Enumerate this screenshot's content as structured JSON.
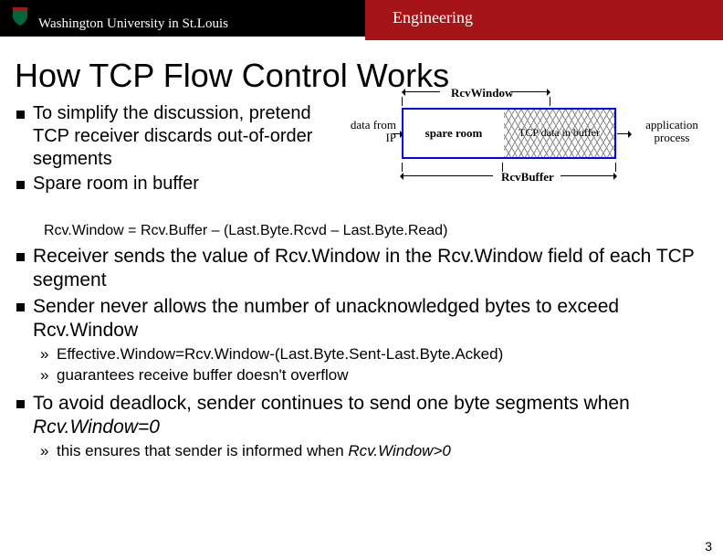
{
  "header": {
    "university": "Washington University in St.Louis",
    "dept": "Engineering"
  },
  "title": "How TCP Flow Control Works",
  "bullets_top": [
    "To simplify the discussion, pretend TCP receiver discards out-of-order segments",
    "Spare room in buffer"
  ],
  "diagram": {
    "rcvwindow": "RcvWindow",
    "data_from": "data from IP",
    "spare": "spare room",
    "tcp_data": "TCP data in buffer",
    "app_proc": "application process",
    "rcvbuffer": "RcvBuffer"
  },
  "formula": "Rcv.Window = Rcv.Buffer – (Last.Byte.Rcvd – Last.Byte.Read)",
  "bullets_main": [
    "Receiver sends the value of Rcv.Window in the Rcv.Window field of each TCP segment",
    "Sender never allows the number of unacknowledged bytes to exceed Rcv.Window"
  ],
  "sub1": [
    "Effective.Window=Rcv.Window-(Last.Byte.Sent-Last.Byte.Acked)",
    "guarantees receive buffer doesn't overflow"
  ],
  "bullet_last_pre": "To avoid deadlock, sender continues to send one byte segments when ",
  "bullet_last_ital": "Rcv.Window=0",
  "sub2_pre": "this ensures that sender is informed when ",
  "sub2_ital": "Rcv.Window>0",
  "page": "3"
}
